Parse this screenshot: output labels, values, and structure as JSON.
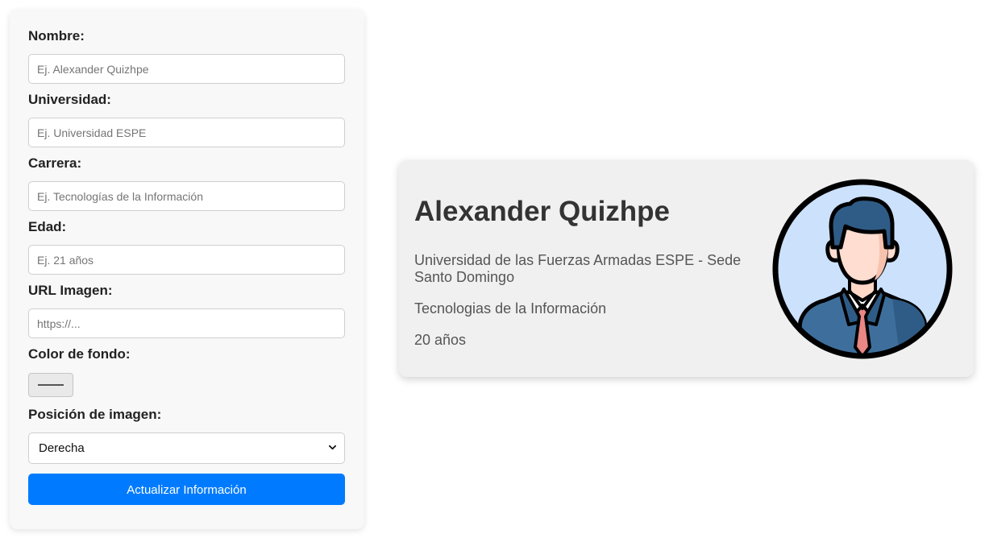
{
  "form": {
    "fields": [
      {
        "label": "Nombre:",
        "placeholder": "Ej. Alexander Quizhpe",
        "value": ""
      },
      {
        "label": "Universidad:",
        "placeholder": "Ej. Universidad ESPE",
        "value": ""
      },
      {
        "label": "Carrera:",
        "placeholder": "Ej. Tecnologías de la Información",
        "value": ""
      },
      {
        "label": "Edad:",
        "placeholder": "Ej. 21 años",
        "value": ""
      },
      {
        "label": "URL Imagen:",
        "placeholder": "https://...",
        "value": ""
      }
    ],
    "color_label": "Color de fondo:",
    "color_value": "#f0f0f0",
    "position_label": "Posición de imagen:",
    "position_selected": "Derecha",
    "submit_label": "Actualizar Información",
    "accent_color": "#007bff"
  },
  "card": {
    "name": "Alexander Quizhpe",
    "university": "Universidad de las Fuerzas Armadas ESPE - Sede Santo Domingo",
    "career": "Tecnologias de la Información",
    "age": "20 años",
    "avatar_icon": "businessman-avatar-icon",
    "background": "#f0f0f0"
  }
}
